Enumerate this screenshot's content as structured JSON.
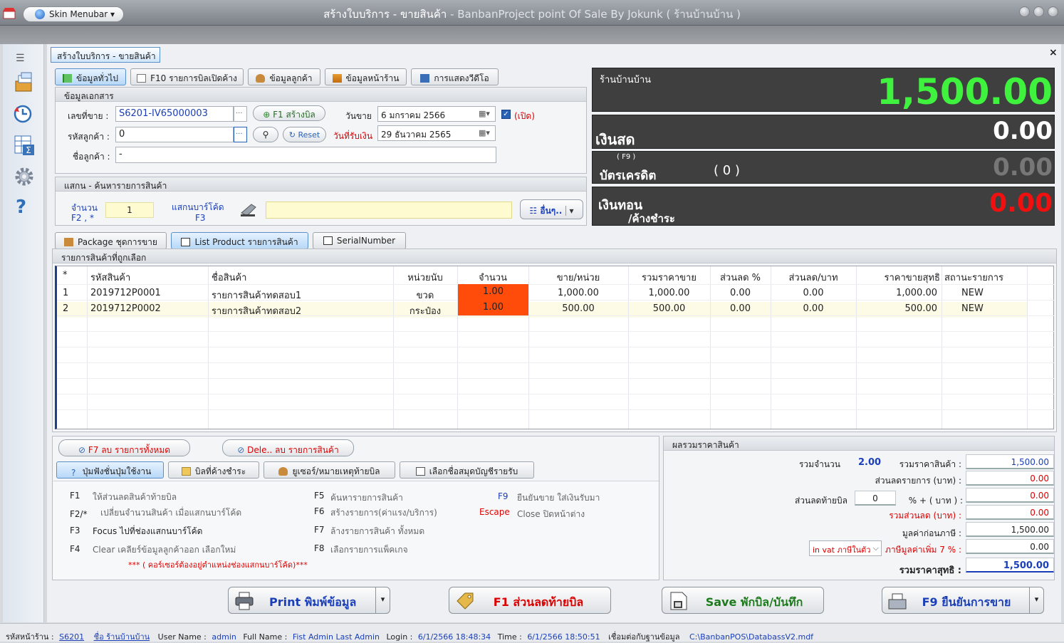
{
  "window": {
    "title_main": "สร้างใบบริการ - ขายสินค้า",
    "title_dim": " - BanbanProject point Of Sale By Jokunk  ( ร้านบ้านบ้าน )",
    "skin_menu": "Skin Menubar"
  },
  "doc_tab": "สร้างใบบริการ - ขายสินค้า",
  "close_label": "×",
  "top_tabs": [
    "ข้อมูลทั่วไป",
    "F10 รายการบิลเปิดค้าง",
    "ข้อมูลลูกค้า",
    "ข้อมูลหน้าร้าน",
    "การแสดงวีดีโอ"
  ],
  "doc": {
    "header": "ข้อมูลเอกสาร",
    "bill_no_label": "เลขที่ขาย :",
    "bill_no": "S6201-IV65000003",
    "create_btn": "F1 สร้างบิล",
    "customer_code_label": "รหัสลูกค้า :",
    "customer_code": "0",
    "reset_btn": "Reset",
    "customer_name_label": "ชื่อลูกค้า :",
    "customer_name": "-",
    "sale_date_label": "วันขาย",
    "sale_date": "6   มกราคม      2566",
    "receive_date_label": "วันที่รับเงิน",
    "receive_date": "29   ธันวาคม      2565",
    "open_label": "(เปิด)"
  },
  "scan": {
    "header": "แสกน - ค้นหารายการสินค้า",
    "qty_label": "จำนวน",
    "qty_key": "F2 ,  *",
    "qty": "1",
    "barcode_label": "แสกนบาร์โค้ด",
    "barcode_key": "F3",
    "other_btn": "อื่นๆ.."
  },
  "display": {
    "shop": "ร้านบ้านบ้าน",
    "total": "1,500.00",
    "cash_label": "เงินสด",
    "cash": "0.00",
    "credit_key": "( F9 )",
    "credit_label": "บัตรเครดิต",
    "credit_count": "( 0 )",
    "credit": "0.00",
    "change_label": "เงินทอน",
    "change_sub": "/ค้างชำระ",
    "change": "0.00"
  },
  "list_tabs": [
    "Package ชุดการขาย",
    "List Product รายการสินค้า",
    "SerialNumber"
  ],
  "grid": {
    "header": "รายการสินค้าที่ถูกเลือก",
    "columns": [
      "*",
      "รหัสสินค้า",
      "ชื่อสินค้า",
      "หน่วยนับ",
      "จำนวน",
      "ขาย/หน่วย",
      "รวมราคาขาย",
      "ส่วนลด %",
      "ส่วนลด/บาท",
      "ราคาขายสุทธิ",
      "สถานะรายการ"
    ],
    "rows": [
      [
        "1",
        "2019712P0001",
        "รายการสินค้าทดสอบ1",
        "ขวด",
        "1.00",
        "1,000.00",
        "1,000.00",
        "0.00",
        "0.00",
        "1,000.00",
        "NEW"
      ],
      [
        "2",
        "2019712P0002",
        "รายการสินค้าทดสอบ2",
        "กระป๋อง",
        "1.00",
        "500.00",
        "500.00",
        "0.00",
        "0.00",
        "500.00",
        "NEW"
      ]
    ]
  },
  "actions": {
    "del_all": "F7 ลบ รายการทั้งหมด",
    "del_one": "Dele.. ลบ รายการสินค้า"
  },
  "bottom_tabs": [
    "ปุ่มฟังชั่นปุ่มใช้งาน",
    "บิลที่ค้างชำระ",
    "ยูเซอร์/หมายเหตุท้ายบิล",
    "เลือกชื่อสมุดบัญชีรายรับ"
  ],
  "fkeys": [
    [
      "F1",
      "ให้ส่วนลดสินค้าท้ายบิล"
    ],
    [
      "F2/*",
      "เปลี่ยนจำนวนสินค้า เมื่อแสกนบาร์โค้ด"
    ],
    [
      "F3",
      "Focus ไปที่ช่องแสกนบาร์โค้ด"
    ],
    [
      "F4",
      "Clear เคลียร์ข้อมูลลูกค้าออก เลือกใหม่"
    ],
    [
      "F5",
      "ค้นหารายการสินค้า"
    ],
    [
      "F6",
      "สร้างรายการ(ค่าแรง/บริการ)"
    ],
    [
      "F7",
      "ล้างรายการสินค้า ทั้งหมด"
    ],
    [
      "F8",
      "เลือกรายการแพ็คเกจ"
    ],
    [
      "F9",
      "ยืนยันขาย ใส่เงินรับมา"
    ],
    [
      "Escape",
      "Close ปิดหน้าต่าง"
    ]
  ],
  "fk_note": "*** ( คอร์เซอร์ต้องอยู่ตำแหน่งช่องแสกนบาร์โค้ด)***",
  "summary": {
    "header": "ผลรวมราคาสินค้า",
    "qty_label": "รวมจำนวน",
    "qty": "2.00",
    "total_label": "รวมราคาสินค้า :",
    "total": "1,500.00",
    "item_disc_label": "ส่วนลดรายการ (บาท) :",
    "item_disc": "0.00",
    "bill_disc_label": "ส่วนลดท้ายบิล",
    "bill_disc_pct": "0",
    "pct_plus": "%  +  ( บาท ) :",
    "bill_disc": "0.00",
    "sum_disc_label": "รวมส่วนลด (บาท) :",
    "sum_disc": "0.00",
    "pre_tax_label": "มูลค่าก่อนภาษี :",
    "pre_tax": "1,500.00",
    "vat_mode": "in vat ภาษีในตัว",
    "vat_label": "ภาษีมูลค่าเพิ่ม 7 % :",
    "vat": "0.00",
    "net_label": "รวมราคาสุทธิ :",
    "net": "1,500.00"
  },
  "buttons": {
    "print": "Print พิมพ์ข้อมูล",
    "discount": "F1 ส่วนลดท้ายบิล",
    "save": "Save พักบิล/บันทึก",
    "confirm": "F9 ยืนยันการขาย"
  },
  "status": {
    "shop_code_label": "รหัสหน้าร้าน :",
    "shop_code": "S6201",
    "shop_name": "ชื่อ ร้านบ้านบ้าน",
    "user_label": "User Name :",
    "user": "admin",
    "full_label": "Full Name :",
    "full": "Fist Admin Last Admin",
    "login_label": "Login :",
    "login": "6/1/2566 18:48:34",
    "time_label": "Time :",
    "time": "6/1/2566 18:50:51",
    "db_label": "เชื่อมต่อกับฐานข้อมูล",
    "db": "C:\\BanbanPOS\\DatabassV2.mdf"
  }
}
